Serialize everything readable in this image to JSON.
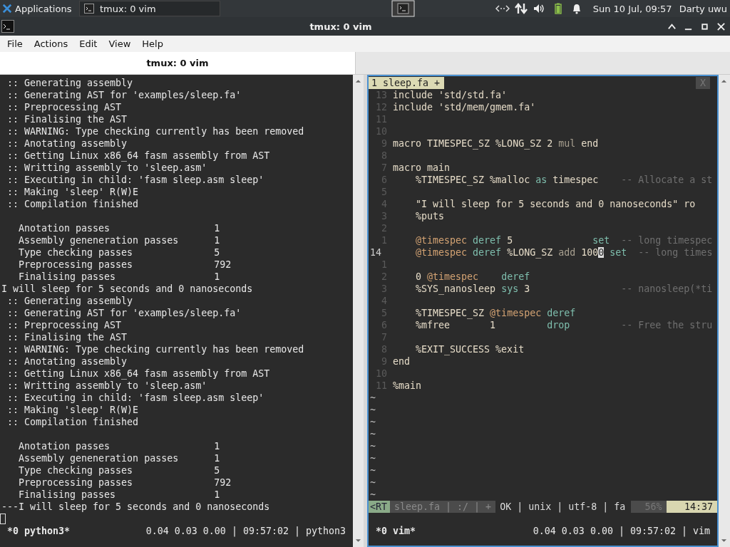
{
  "top_panel": {
    "apps_menu": "Applications",
    "taskbar_button": "tmux: 0 vim",
    "clock": "Sun 10 Jul, 09:57",
    "user": "Darty uwu"
  },
  "window": {
    "title": "tmux: 0 vim"
  },
  "menu": [
    "File",
    "Actions",
    "Edit",
    "View",
    "Help"
  ],
  "tabs": [
    {
      "label": "tmux: 0 vim",
      "selected": true
    }
  ],
  "left_pane": {
    "focused": false,
    "lines": [
      {
        "kind": "log",
        "text": ":: Generating assembly"
      },
      {
        "kind": "log",
        "text": ":: Generating AST for 'examples/sleep.fa'"
      },
      {
        "kind": "log",
        "text": ":: Preprocessing AST"
      },
      {
        "kind": "log",
        "text": ":: Finalising the AST"
      },
      {
        "kind": "log",
        "text": ":: WARNING: Type checking currently has been removed"
      },
      {
        "kind": "log",
        "text": ":: Anotating assembly"
      },
      {
        "kind": "log",
        "text": ":: Getting Linux x86_64 fasm assembly from AST"
      },
      {
        "kind": "log",
        "text": ":: Writting assembly to 'sleep.asm'"
      },
      {
        "kind": "log",
        "text": ":: Executing in child: 'fasm sleep.asm sleep'"
      },
      {
        "kind": "log",
        "text": ":: Making 'sleep' R(W)E"
      },
      {
        "kind": "log",
        "text": ":: Compilation finished"
      },
      {
        "kind": "blank"
      },
      {
        "kind": "stat",
        "label": "Anotation passes",
        "value": "1"
      },
      {
        "kind": "stat",
        "label": "Assembly geneneration passes",
        "value": "1"
      },
      {
        "kind": "stat",
        "label": "Type checking passes",
        "value": "5"
      },
      {
        "kind": "stat",
        "label": "Preprocessing passes",
        "value": "792"
      },
      {
        "kind": "stat",
        "label": "Finalising passes",
        "value": "1"
      },
      {
        "kind": "output",
        "text": "I will sleep for 5 seconds and 0 nanoseconds"
      },
      {
        "kind": "log",
        "text": ":: Generating assembly"
      },
      {
        "kind": "log",
        "text": ":: Generating AST for 'examples/sleep.fa'"
      },
      {
        "kind": "log",
        "text": ":: Preprocessing AST"
      },
      {
        "kind": "log",
        "text": ":: Finalising the AST"
      },
      {
        "kind": "log",
        "text": ":: WARNING: Type checking currently has been removed"
      },
      {
        "kind": "log",
        "text": ":: Anotating assembly"
      },
      {
        "kind": "log",
        "text": ":: Getting Linux x86_64 fasm assembly from AST"
      },
      {
        "kind": "log",
        "text": ":: Writting assembly to 'sleep.asm'"
      },
      {
        "kind": "log",
        "text": ":: Executing in child: 'fasm sleep.asm sleep'"
      },
      {
        "kind": "log",
        "text": ":: Making 'sleep' R(W)E"
      },
      {
        "kind": "log",
        "text": ":: Compilation finished"
      },
      {
        "kind": "blank"
      },
      {
        "kind": "stat",
        "label": "Anotation passes",
        "value": "1"
      },
      {
        "kind": "stat",
        "label": "Assembly geneneration passes",
        "value": "1"
      },
      {
        "kind": "stat",
        "label": "Type checking passes",
        "value": "5"
      },
      {
        "kind": "stat",
        "label": "Preprocessing passes",
        "value": "792"
      },
      {
        "kind": "stat",
        "label": "Finalising passes",
        "value": "1"
      },
      {
        "kind": "output",
        "text": "---I will sleep for 5 seconds and 0 nanoseconds"
      },
      {
        "kind": "cursor"
      }
    ],
    "status": {
      "window": "*0 python3*",
      "info": "0.04 0.03 0.00 | 09:57:02 | python3"
    }
  },
  "right_pane": {
    "focused": true,
    "buffer_tab": "1 sleep.fa +",
    "close_label": "X",
    "code": [
      {
        "number": "13",
        "current": false,
        "tokens": [
          {
            "kind": "plain",
            "text": "include 'std/std.fa'"
          }
        ]
      },
      {
        "number": "12",
        "current": false,
        "tokens": [
          {
            "kind": "plain",
            "text": "include 'std/mem/gmem.fa'"
          }
        ]
      },
      {
        "number": "11",
        "current": false
      },
      {
        "number": "10",
        "current": false
      },
      {
        "number": "9",
        "current": false,
        "tokens": [
          {
            "kind": "plain",
            "text": "macro TIMESPEC_SZ %LONG_SZ 2 "
          },
          {
            "kind": "op",
            "text": "mul"
          },
          {
            "kind": "plain",
            "text": " end"
          }
        ]
      },
      {
        "number": "8",
        "current": false
      },
      {
        "number": "7",
        "current": false,
        "tokens": [
          {
            "kind": "plain",
            "text": "macro main"
          }
        ]
      },
      {
        "number": "6",
        "current": false,
        "tokens": [
          {
            "kind": "plain",
            "text": "    %TIMESPEC_SZ %malloc "
          },
          {
            "kind": "builtin",
            "text": "as"
          },
          {
            "kind": "plain",
            "text": " timespec    "
          },
          {
            "kind": "comment",
            "text": "-- Allocate a st"
          }
        ]
      },
      {
        "number": "5",
        "current": false
      },
      {
        "number": "4",
        "current": false,
        "tokens": [
          {
            "kind": "plain",
            "text": "    \"I will sleep for 5 seconds and 0 nanoseconds\" ro"
          }
        ]
      },
      {
        "number": "3",
        "current": false,
        "tokens": [
          {
            "kind": "plain",
            "text": "    %puts"
          }
        ]
      },
      {
        "number": "2",
        "current": false
      },
      {
        "number": "1",
        "current": false,
        "tokens": [
          {
            "kind": "var",
            "text": "    @timespec "
          },
          {
            "kind": "builtin",
            "text": "deref"
          },
          {
            "kind": "plain",
            "text": " 5              "
          },
          {
            "kind": "builtin",
            "text": "set  "
          },
          {
            "kind": "comment",
            "text": "-- long timespec"
          }
        ]
      },
      {
        "number": "14",
        "current": true,
        "tokens": [
          {
            "kind": "var",
            "text": "    @timespec "
          },
          {
            "kind": "builtin",
            "text": "deref"
          },
          {
            "kind": "plain",
            "text": " %LONG_SZ "
          },
          {
            "kind": "op",
            "text": "add"
          },
          {
            "kind": "plain",
            "text": " 100"
          },
          {
            "kind": "cursor",
            "text": "0"
          },
          {
            "kind": "builtin",
            "text": " set  "
          },
          {
            "kind": "comment",
            "text": "-- long times"
          }
        ]
      },
      {
        "number": "1",
        "current": false
      },
      {
        "number": "2",
        "current": false,
        "tokens": [
          {
            "kind": "plain",
            "text": "    0 "
          },
          {
            "kind": "var",
            "text": "@timespec    "
          },
          {
            "kind": "builtin",
            "text": "deref"
          }
        ]
      },
      {
        "number": "3",
        "current": false,
        "tokens": [
          {
            "kind": "plain",
            "text": "    %SYS_nanosleep "
          },
          {
            "kind": "builtin",
            "text": "sys"
          },
          {
            "kind": "plain",
            "text": " 3                "
          },
          {
            "kind": "comment",
            "text": "-- nanosleep(*ti"
          }
        ]
      },
      {
        "number": "4",
        "current": false
      },
      {
        "number": "5",
        "current": false,
        "tokens": [
          {
            "kind": "plain",
            "text": "    %TIMESPEC_SZ "
          },
          {
            "kind": "var",
            "text": "@timespec "
          },
          {
            "kind": "builtin",
            "text": "deref"
          }
        ]
      },
      {
        "number": "6",
        "current": false,
        "tokens": [
          {
            "kind": "plain",
            "text": "    %mfree       1         "
          },
          {
            "kind": "builtin",
            "text": "drop         "
          },
          {
            "kind": "comment",
            "text": "-- Free the stru"
          }
        ]
      },
      {
        "number": "7",
        "current": false
      },
      {
        "number": "8",
        "current": false,
        "tokens": [
          {
            "kind": "plain",
            "text": "    %EXIT_SUCCESS %exit"
          }
        ]
      },
      {
        "number": "9",
        "current": false,
        "tokens": [
          {
            "kind": "plain",
            "text": "end"
          }
        ]
      },
      {
        "number": "10",
        "current": false
      },
      {
        "number": "11",
        "current": false,
        "tokens": [
          {
            "kind": "plain",
            "text": "%main"
          }
        ]
      }
    ],
    "filler": [
      "~",
      "~",
      "~",
      "~",
      "~",
      "~",
      "~",
      "~",
      "~"
    ],
    "statusline": [
      {
        "kind": "mode",
        "text": "<RT"
      },
      {
        "kind": "file",
        "text": "sleep.fa | :/ | +"
      },
      {
        "kind": "info",
        "text": "OK | unix | utf-8 | fa"
      },
      {
        "kind": "percent",
        "text": "56%"
      },
      {
        "kind": "position",
        "text": "14:37"
      }
    ],
    "status": {
      "window": "*0 vim*",
      "info": "0.04 0.03 0.00 | 09:57:02 | vim"
    }
  }
}
